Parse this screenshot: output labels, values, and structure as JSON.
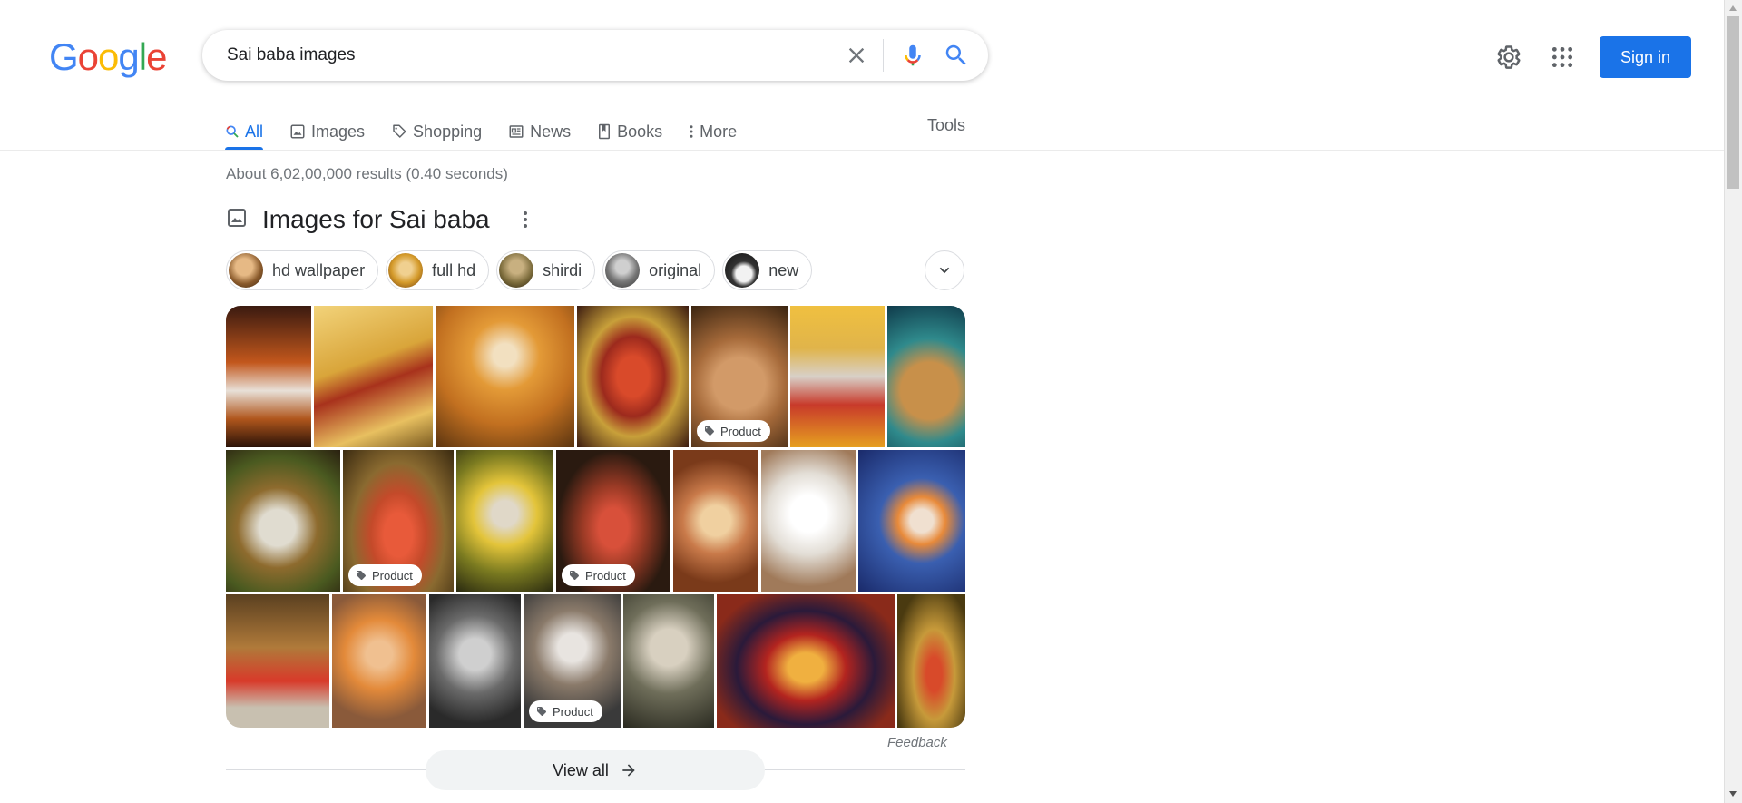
{
  "header": {
    "logo_letters": [
      "G",
      "o",
      "o",
      "g",
      "l",
      "e"
    ],
    "logo_colors": [
      "#4285f4",
      "#ea4335",
      "#fbbc05",
      "#4285f4",
      "#34a853",
      "#ea4335"
    ],
    "search_query": "Sai baba images",
    "sign_in_label": "Sign in"
  },
  "tabs": [
    {
      "label": "All",
      "icon": "search-icon",
      "active": true
    },
    {
      "label": "Images",
      "icon": "image-icon"
    },
    {
      "label": "Shopping",
      "icon": "tag-icon"
    },
    {
      "label": "News",
      "icon": "newspaper-icon"
    },
    {
      "label": "Books",
      "icon": "book-icon"
    },
    {
      "label": "More",
      "icon": "more-vertical-icon"
    }
  ],
  "tools_label": "Tools",
  "result_stats": "About 6,02,00,000 results (0.40 seconds)",
  "images_section": {
    "title": "Images for Sai baba",
    "chips": [
      {
        "label": "hd wallpaper",
        "color": "#8a5a2b"
      },
      {
        "label": "full hd",
        "color": "#d49a2a"
      },
      {
        "label": "shirdi",
        "color": "#7a6a3a"
      },
      {
        "label": "original",
        "color": "#555555"
      },
      {
        "label": "new",
        "color": "#2b2b2b"
      }
    ],
    "product_label": "Product",
    "rows": [
      [
        {
          "color": "#c2571c",
          "product": false
        },
        {
          "color": "#d9a53a",
          "product": false
        },
        {
          "color": "#e39a37",
          "product": false
        },
        {
          "color": "#9c2a1d",
          "product": false
        },
        {
          "color": "#a66a3a",
          "product": true
        },
        {
          "color": "#e0b44a",
          "product": false
        },
        {
          "color": "#2f8a8c",
          "product": false
        }
      ],
      [
        {
          "color": "#8e6b2e",
          "product": false
        },
        {
          "color": "#c44a2a",
          "product": true
        },
        {
          "color": "#e3c43a",
          "product": false
        },
        {
          "color": "#9a3a25",
          "product": true
        },
        {
          "color": "#c97a4a",
          "product": false
        },
        {
          "color": "#e2ddd5",
          "product": false
        },
        {
          "color": "#3a5fb0",
          "product": false
        }
      ],
      [
        {
          "color": "#b07a3a",
          "product": false
        },
        {
          "color": "#e38a3a",
          "product": false
        },
        {
          "color": "#6a6a6a",
          "product": false
        },
        {
          "color": "#8a7a6a",
          "product": true
        },
        {
          "color": "#6f6e5a",
          "product": false
        },
        {
          "color": "#b3241f",
          "product": false
        },
        {
          "color": "#c79a3a",
          "product": false
        }
      ]
    ],
    "feedback_label": "Feedback",
    "view_all_label": "View all"
  }
}
